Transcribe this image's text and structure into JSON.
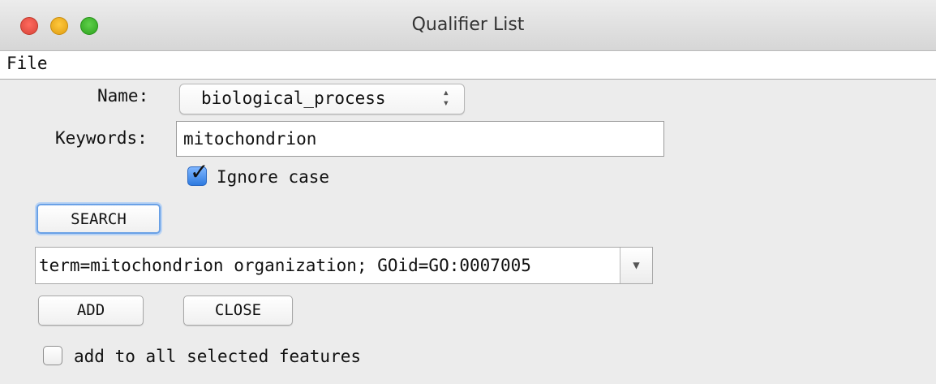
{
  "window": {
    "title": "Qualifier List"
  },
  "menu": {
    "file": "File"
  },
  "name_field": {
    "label": "Name:",
    "value": "biological_process"
  },
  "keywords_field": {
    "label": "Keywords:",
    "value": "mitochondrion"
  },
  "ignore_case": {
    "label": "Ignore case",
    "checked": true
  },
  "search_button": {
    "label": "SEARCH"
  },
  "result_combo": {
    "value": "term=mitochondrion organization; GOid=GO:0007005"
  },
  "add_button": {
    "label": "ADD"
  },
  "close_button": {
    "label": "CLOSE"
  },
  "add_all": {
    "label": "add to all selected features",
    "checked": false
  }
}
